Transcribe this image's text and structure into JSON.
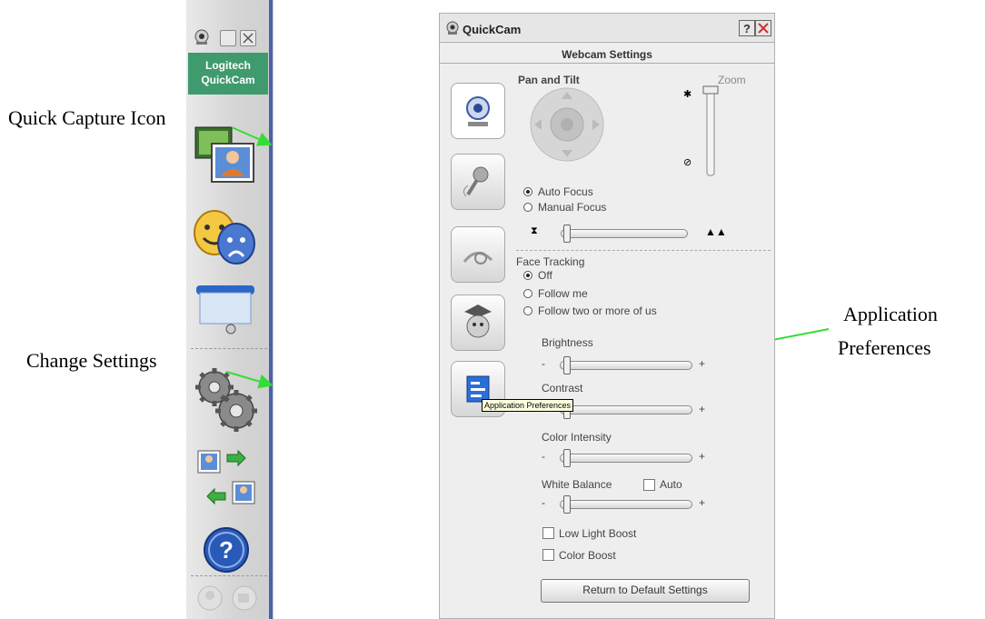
{
  "annotations": {
    "quick_capture": "Quick Capture Icon",
    "change_settings": "Change Settings",
    "app_prefs_line1": "Application",
    "app_prefs_line2": "Preferences"
  },
  "toolbar": {
    "brand_line1": "Logitech",
    "brand_line2": "QuickCam",
    "icons": [
      "webcam-icon",
      "quick-capture-icon",
      "effects-icon",
      "video-messaging-icon",
      "settings-icon",
      "video-call-icon",
      "help-icon"
    ]
  },
  "window": {
    "title": "QuickCam",
    "help_glyph": "?",
    "subtitle": "Webcam Settings",
    "pan_tilt_label": "Pan and Tilt",
    "zoom_label": "Zoom",
    "focus_options": [
      "Auto Focus",
      "Manual Focus"
    ],
    "focus_selected": "Auto Focus",
    "face_tracking_label": "Face Tracking",
    "face_tracking_options": [
      "Off",
      "Follow me",
      "Follow two or more of us"
    ],
    "face_tracking_selected": "Off",
    "brightness_label": "Brightness",
    "contrast_label": "Contrast",
    "color_intensity_label": "Color Intensity",
    "white_balance_label": "White Balance",
    "white_balance_auto_label": "Auto",
    "low_light_label": "Low Light Boost",
    "color_boost_label": "Color Boost",
    "reset_label": "Return to Default Settings",
    "minus": "-",
    "plus": "+",
    "tooltip": "Application Preferences",
    "tabs": [
      "camera-tab",
      "audio-tab",
      "effects-tab",
      "avatar-tab",
      "application-preferences-tab"
    ]
  },
  "colors": {
    "arrow": "#33dd33",
    "brand_green": "#3f9a6e",
    "help_blue": "#2a5ab8"
  }
}
